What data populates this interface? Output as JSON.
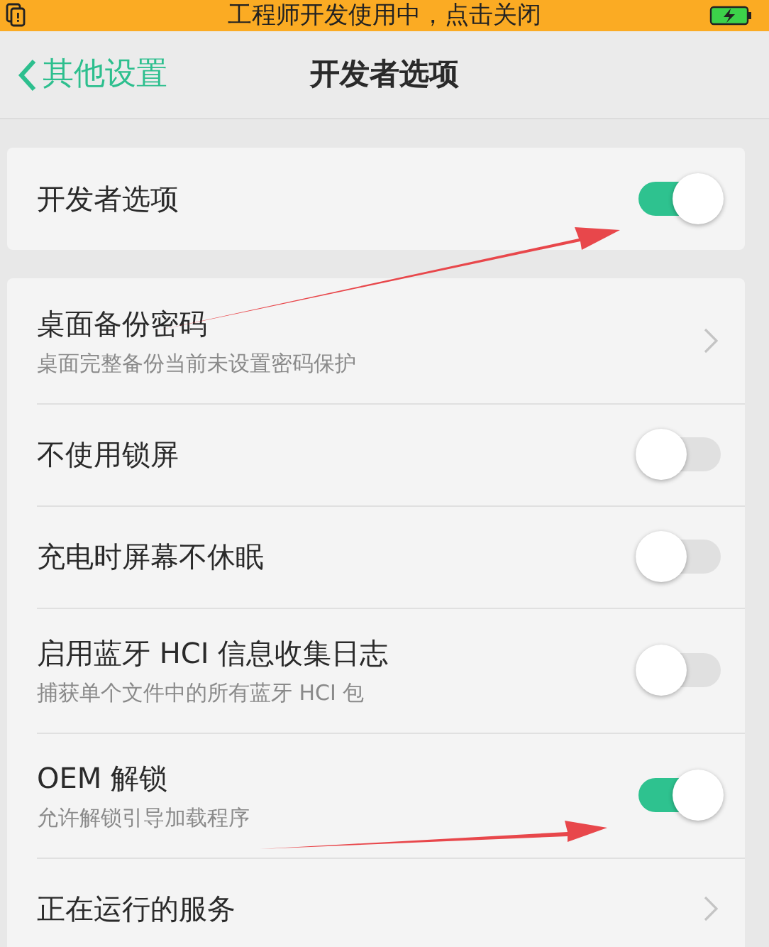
{
  "status_bar": {
    "message": "工程师开发使用中，点击关闭"
  },
  "header": {
    "back_label": "其他设置",
    "title": "开发者选项"
  },
  "groups": [
    {
      "rows": [
        {
          "kind": "toggle",
          "title": "开发者选项",
          "on": true
        }
      ]
    },
    {
      "rows": [
        {
          "kind": "link",
          "title": "桌面备份密码",
          "subtitle": "桌面完整备份当前未设置密码保护"
        },
        {
          "kind": "toggle",
          "title": "不使用锁屏",
          "on": false
        },
        {
          "kind": "toggle",
          "title": "充电时屏幕不休眠",
          "on": false
        },
        {
          "kind": "toggle",
          "title": "启用蓝牙 HCI 信息收集日志",
          "subtitle": "捕获单个文件中的所有蓝牙 HCI 包",
          "on": false
        },
        {
          "kind": "toggle",
          "title": "OEM 解锁",
          "subtitle": "允许解锁引导加载程序",
          "on": true
        },
        {
          "kind": "link",
          "title": "正在运行的服务"
        }
      ]
    }
  ]
}
